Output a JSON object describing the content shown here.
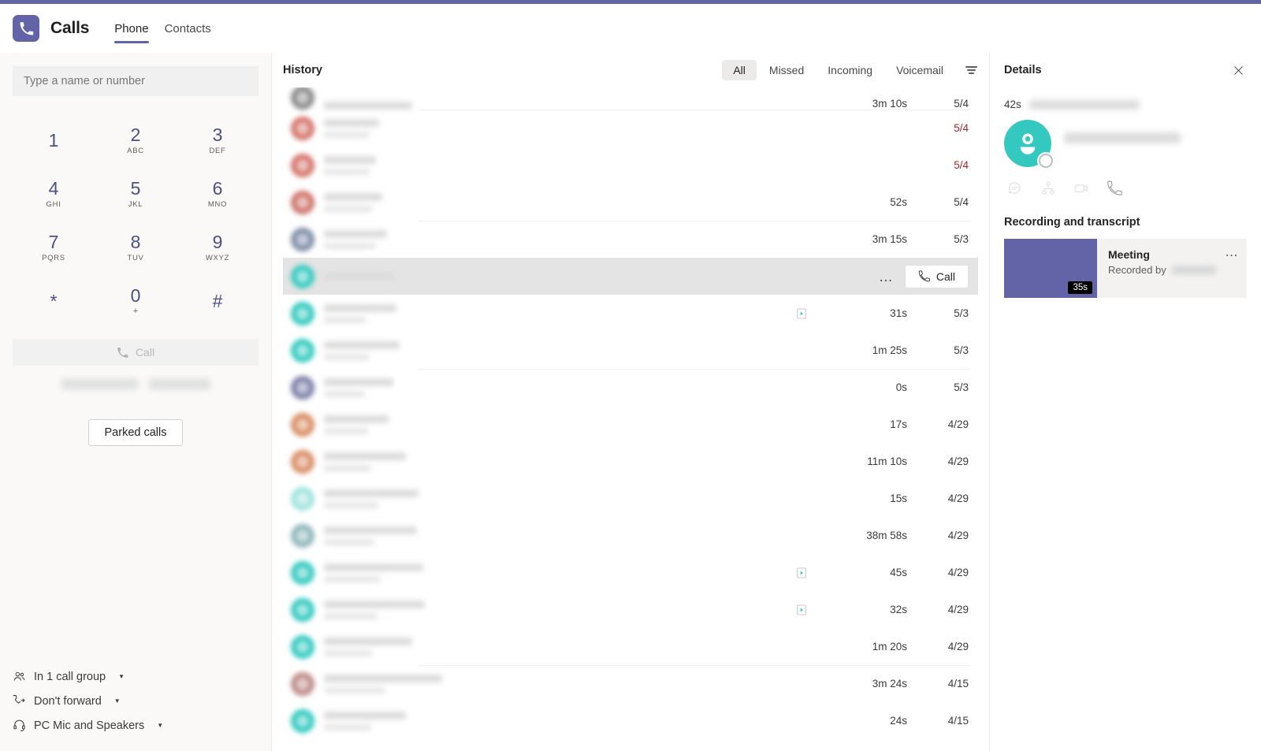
{
  "window": {
    "accent_color": "#6264A7"
  },
  "header": {
    "app_icon": "phone-icon",
    "title": "Calls",
    "tabs": [
      {
        "label": "Phone",
        "active": true
      },
      {
        "label": "Contacts",
        "active": false
      }
    ]
  },
  "dialpad_panel": {
    "search": {
      "placeholder": "Type a name or number",
      "value": ""
    },
    "keys": [
      {
        "digit": "1",
        "letters": ""
      },
      {
        "digit": "2",
        "letters": "ABC"
      },
      {
        "digit": "3",
        "letters": "DEF"
      },
      {
        "digit": "4",
        "letters": "GHI"
      },
      {
        "digit": "5",
        "letters": "JKL"
      },
      {
        "digit": "6",
        "letters": "MNO"
      },
      {
        "digit": "7",
        "letters": "PQRS"
      },
      {
        "digit": "8",
        "letters": "TUV"
      },
      {
        "digit": "9",
        "letters": "WXYZ"
      },
      {
        "digit": "*",
        "letters": ""
      },
      {
        "digit": "0",
        "letters": "+"
      },
      {
        "digit": "#",
        "letters": ""
      }
    ],
    "call_button": {
      "label": "Call",
      "icon": "phone-icon",
      "disabled": true
    },
    "parked_calls_button": {
      "label": "Parked calls"
    },
    "footer": [
      {
        "icon": "people-icon",
        "label": "In 1 call group",
        "has_caret": true
      },
      {
        "icon": "call-forward-icon",
        "label": "Don't forward",
        "has_caret": true
      },
      {
        "icon": "headset-icon",
        "label": "PC Mic and Speakers",
        "has_caret": true
      }
    ]
  },
  "history_panel": {
    "title": "History",
    "filters": [
      {
        "label": "All",
        "active": true
      },
      {
        "label": "Missed",
        "active": false
      },
      {
        "label": "Incoming",
        "active": false
      },
      {
        "label": "Voicemail",
        "active": false
      }
    ],
    "filter_icon": "filter-icon",
    "rows": [
      {
        "avatar_color": "#8A8A8A",
        "duration": "3m 10s",
        "date": "5/4",
        "missed": false,
        "has_recording": false,
        "clipped_top": true,
        "hovered": false,
        "separator": false
      },
      {
        "avatar_color": "#D5736A",
        "duration": "",
        "date": "5/4",
        "missed": true,
        "has_recording": false,
        "clipped_top": false,
        "hovered": false,
        "separator": true
      },
      {
        "avatar_color": "#D5736A",
        "duration": "",
        "date": "5/4",
        "missed": true,
        "has_recording": false,
        "clipped_top": false,
        "hovered": false,
        "separator": false
      },
      {
        "avatar_color": "#CE7368",
        "duration": "52s",
        "date": "5/4",
        "missed": false,
        "has_recording": false,
        "clipped_top": false,
        "hovered": false,
        "separator": false
      },
      {
        "avatar_color": "#7D8CA8",
        "duration": "3m 15s",
        "date": "5/3",
        "missed": false,
        "has_recording": false,
        "clipped_top": false,
        "hovered": false,
        "separator": true
      },
      {
        "avatar_color": "#33C9C0",
        "duration": "",
        "date": "",
        "missed": false,
        "has_recording": false,
        "clipped_top": false,
        "hovered": true,
        "separator": false
      },
      {
        "avatar_color": "#33C9C0",
        "duration": "31s",
        "date": "5/3",
        "missed": false,
        "has_recording": true,
        "clipped_top": false,
        "hovered": false,
        "separator": false
      },
      {
        "avatar_color": "#33C9C0",
        "duration": "1m 25s",
        "date": "5/3",
        "missed": false,
        "has_recording": false,
        "clipped_top": false,
        "hovered": false,
        "separator": false
      },
      {
        "avatar_color": "#7C7FA8",
        "duration": "0s",
        "date": "5/3",
        "missed": false,
        "has_recording": false,
        "clipped_top": false,
        "hovered": false,
        "separator": true
      },
      {
        "avatar_color": "#D98C63",
        "duration": "17s",
        "date": "4/29",
        "missed": false,
        "has_recording": false,
        "clipped_top": false,
        "hovered": false,
        "separator": false
      },
      {
        "avatar_color": "#D98C63",
        "duration": "11m 10s",
        "date": "4/29",
        "missed": false,
        "has_recording": false,
        "clipped_top": false,
        "hovered": false,
        "separator": false
      },
      {
        "avatar_color": "#9FE3DD",
        "duration": "15s",
        "date": "4/29",
        "missed": false,
        "has_recording": false,
        "clipped_top": false,
        "hovered": false,
        "separator": false
      },
      {
        "avatar_color": "#8FB6BC",
        "duration": "38m 58s",
        "date": "4/29",
        "missed": false,
        "has_recording": false,
        "clipped_top": false,
        "hovered": false,
        "separator": false
      },
      {
        "avatar_color": "#33C9C0",
        "duration": "45s",
        "date": "4/29",
        "missed": false,
        "has_recording": true,
        "clipped_top": false,
        "hovered": false,
        "separator": false
      },
      {
        "avatar_color": "#33C9C0",
        "duration": "32s",
        "date": "4/29",
        "missed": false,
        "has_recording": true,
        "clipped_top": false,
        "hovered": false,
        "separator": false
      },
      {
        "avatar_color": "#33C9C0",
        "duration": "1m 20s",
        "date": "4/29",
        "missed": false,
        "has_recording": false,
        "clipped_top": false,
        "hovered": false,
        "separator": false
      },
      {
        "avatar_color": "#BC8A86",
        "duration": "3m 24s",
        "date": "4/15",
        "missed": false,
        "has_recording": false,
        "clipped_top": false,
        "hovered": false,
        "separator": true
      },
      {
        "avatar_color": "#33C9C0",
        "duration": "24s",
        "date": "4/15",
        "missed": false,
        "has_recording": false,
        "clipped_top": false,
        "hovered": false,
        "separator": false
      }
    ],
    "hovered_row_actions": {
      "overflow_label": "…",
      "call_label": "Call",
      "call_icon": "phone-icon"
    }
  },
  "details_panel": {
    "title": "Details",
    "close_icon": "close-icon",
    "call_duration": "42s",
    "avatar": {
      "color": "#33C9C0",
      "presence": "offline"
    },
    "actions": [
      {
        "icon": "chat-icon"
      },
      {
        "icon": "org-chart-icon"
      },
      {
        "icon": "video-icon"
      },
      {
        "icon": "phone-icon"
      }
    ],
    "recording_section": {
      "title": "Recording and transcript",
      "card": {
        "thumbnail_color": "#6264A7",
        "duration_badge": "35s",
        "name": "Meeting",
        "recorded_by_label": "Recorded by",
        "overflow_label": "…"
      }
    }
  }
}
